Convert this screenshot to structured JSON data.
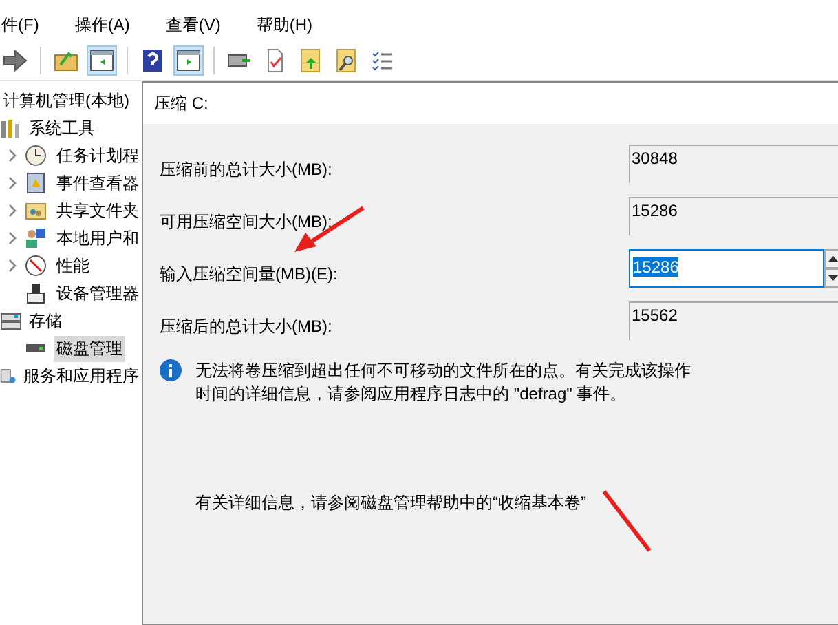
{
  "menu": [
    {
      "label": "件(F)"
    },
    {
      "label": "操作(A)"
    },
    {
      "label": "查看(V)"
    },
    {
      "label": "帮助(H)"
    }
  ],
  "toolbar": [
    {
      "kind": "forward",
      "pressed": false
    },
    {
      "kind": "sep"
    },
    {
      "kind": "folder",
      "pressed": false
    },
    {
      "kind": "pane-left",
      "pressed": true
    },
    {
      "kind": "sep"
    },
    {
      "kind": "help",
      "pressed": false
    },
    {
      "kind": "pane-right",
      "pressed": true
    },
    {
      "kind": "sep"
    },
    {
      "kind": "drive",
      "pressed": false
    },
    {
      "kind": "doc",
      "pressed": false
    },
    {
      "kind": "up",
      "pressed": false
    },
    {
      "kind": "find",
      "pressed": false
    },
    {
      "kind": "list",
      "pressed": false
    }
  ],
  "tree": [
    {
      "label": "计算机管理(本地)",
      "selected": false,
      "children": [
        {
          "label": "系统工具",
          "selected": false,
          "children": [
            {
              "label": "任务计划程",
              "expanded": false,
              "selected": false
            },
            {
              "label": "事件查看器",
              "expanded": false,
              "selected": false
            },
            {
              "label": "共享文件夹",
              "expanded": false,
              "selected": false
            },
            {
              "label": "本地用户和",
              "expanded": false,
              "selected": false
            },
            {
              "label": "性能",
              "expanded": false,
              "selected": false
            },
            {
              "label": "设备管理器",
              "selected": false
            }
          ]
        },
        {
          "label": "存储",
          "selected": false,
          "children": [
            {
              "label": "磁盘管理",
              "selected": true
            }
          ]
        },
        {
          "label": "服务和应用程序",
          "selected": false
        }
      ]
    }
  ],
  "dialog": {
    "title": "压缩 C:",
    "rows": [
      {
        "label": "压缩前的总计大小(MB):",
        "value": "30848",
        "kind": "readonly"
      },
      {
        "label": "可用压缩空间大小(MB):",
        "value": "15286",
        "kind": "readonly"
      },
      {
        "label": "输入压缩空间量(MB)(E):",
        "value": "15286",
        "kind": "spin",
        "selected": true
      },
      {
        "label": "压缩后的总计大小(MB):",
        "value": "15562",
        "kind": "readonly"
      }
    ],
    "info": "无法将卷压缩到超出任何不可移动的文件所在的点。有关完成该操作时间的详细信息，请参阅应用程序日志中的 \"defrag\" 事件。",
    "help": "有关详细信息，请参阅磁盘管理帮助中的“收缩基本卷”"
  }
}
